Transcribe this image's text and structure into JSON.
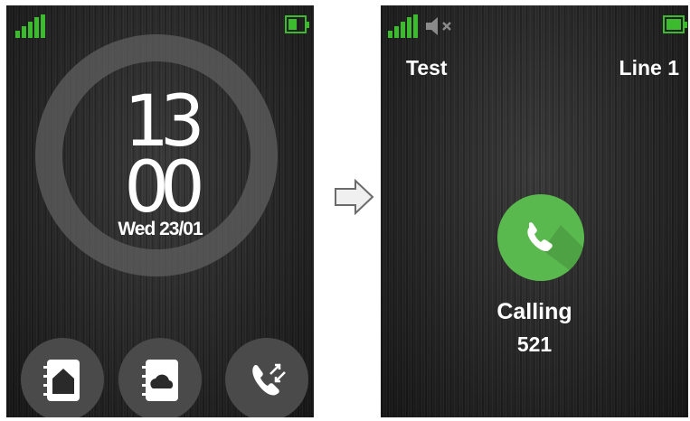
{
  "home": {
    "clock_hours": "13",
    "clock_minutes": "00",
    "date": "Wed 23/01",
    "buttons": [
      {
        "name": "local-phonebook",
        "icon": "house-contacts-icon"
      },
      {
        "name": "cloud-phonebook",
        "icon": "cloud-contacts-icon"
      },
      {
        "name": "call-log",
        "icon": "phone-call-log-icon"
      }
    ]
  },
  "calling": {
    "account": "Test",
    "line": "Line 1",
    "status": "Calling",
    "number": "521",
    "icon": "phone-handset-icon"
  },
  "colors": {
    "status_green": "#3dbb2f",
    "call_green": "#5ab94e",
    "background": "#262626",
    "ring": "#5f5f5f"
  }
}
